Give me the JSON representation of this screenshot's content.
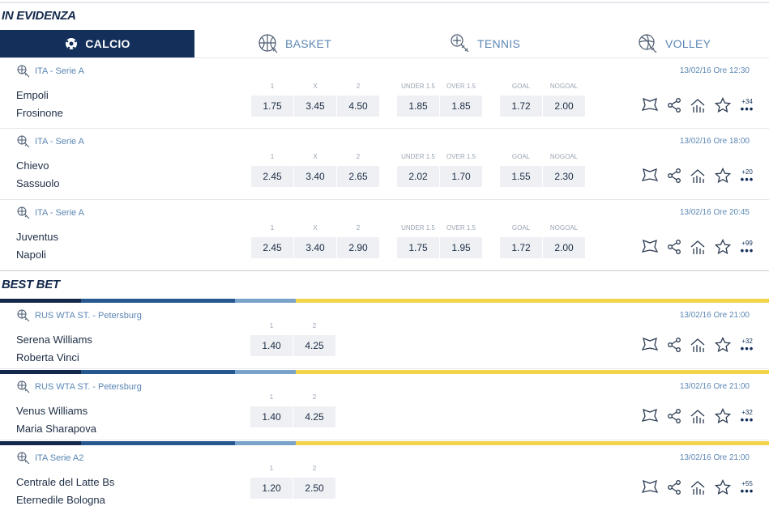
{
  "sections": {
    "featured": "IN EVIDENZA",
    "best_bet": "BEST BET"
  },
  "tabs": [
    {
      "label": "CALCIO",
      "icon": "soccer-ball-icon",
      "active": true
    },
    {
      "label": "BASKET",
      "icon": "basketball-icon",
      "active": false
    },
    {
      "label": "TENNIS",
      "icon": "tennis-icon",
      "active": false
    },
    {
      "label": "VOLLEY",
      "icon": "volleyball-icon",
      "active": false
    }
  ],
  "labels": {
    "one": "1",
    "x": "X",
    "two": "2",
    "under": "UNDER 1.5",
    "over": "OVER 1.5",
    "goal": "GOAL",
    "nogoal": "NOGOAL"
  },
  "featured": [
    {
      "league": "ITA - Serie A",
      "home": "Empoli",
      "away": "Frosinone",
      "date": "13/02/16 Ore 12:30",
      "odds": [
        "1.75",
        "3.45",
        "4.50",
        "1.85",
        "1.85",
        "1.72",
        "2.00"
      ],
      "more": "+34"
    },
    {
      "league": "ITA - Serie A",
      "home": "Chievo",
      "away": "Sassuolo",
      "date": "13/02/16 Ore 18:00",
      "odds": [
        "2.45",
        "3.40",
        "2.65",
        "2.02",
        "1.70",
        "1.55",
        "2.30"
      ],
      "more": "+20"
    },
    {
      "league": "ITA - Serie A",
      "home": "Juventus",
      "away": "Napoli",
      "date": "13/02/16 Ore 20:45",
      "odds": [
        "2.45",
        "3.40",
        "2.90",
        "1.75",
        "1.95",
        "1.72",
        "2.00"
      ],
      "more": "+99"
    }
  ],
  "best_bets": [
    {
      "league": "RUS WTA ST. - Petersburg",
      "home": "Serena Williams",
      "away": "Roberta Vinci",
      "date": "13/02/16 Ore 21:00",
      "odds": [
        "1.40",
        "4.25"
      ],
      "more": "+32"
    },
    {
      "league": "RUS WTA ST. - Petersburg",
      "home": "Venus Williams",
      "away": "Maria Sharapova",
      "date": "13/02/16 Ore 21:00",
      "odds": [
        "1.40",
        "4.25"
      ],
      "more": "+32"
    },
    {
      "league": "ITA Serie A2",
      "home": "Centrale del Latte Bs",
      "away": "Eternedile Bologna",
      "date": "13/02/16 Ore 21:00",
      "odds": [
        "1.20",
        "2.50"
      ],
      "more": "+55"
    }
  ],
  "colors": {
    "navy": "#14305a",
    "link": "#5b87b4",
    "odd_bg": "#eef0f3",
    "stripe_yellow": "#f3d34a"
  }
}
